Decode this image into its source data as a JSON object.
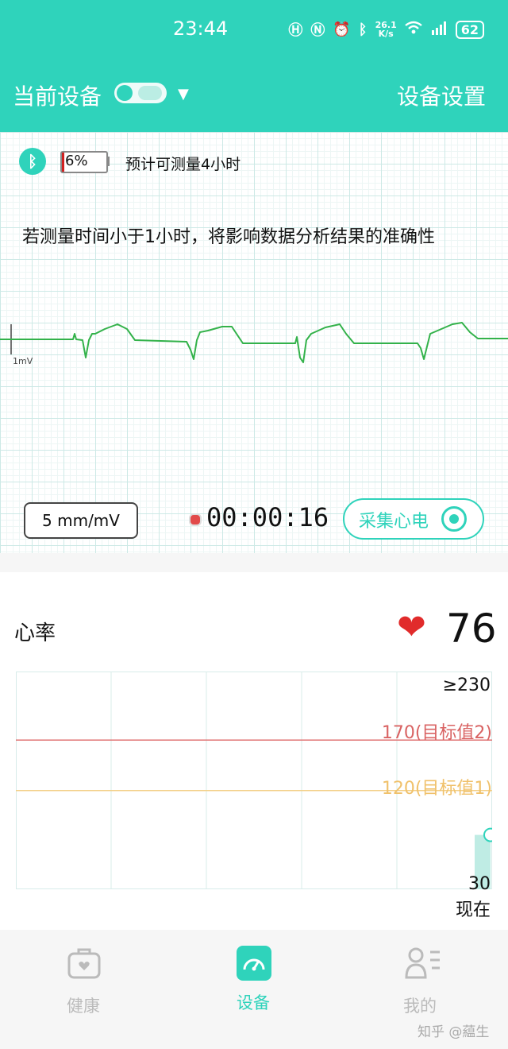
{
  "status_bar": {
    "time": "23:44",
    "net_speed_value": "26.1",
    "net_speed_unit": "K/s",
    "battery_level": "62",
    "icons": [
      "hd-icon",
      "nfc-icon",
      "alarm-icon",
      "bluetooth-icon",
      "wifi-icon",
      "5g-signal-icon"
    ]
  },
  "header": {
    "device_label": "当前设备",
    "settings_label": "设备设置"
  },
  "ecg": {
    "battery_percent": "6%",
    "battery_level": 0.06,
    "estimate_text": "预计可测量4小时",
    "warning_text": "若测量时间小于1小时，将影响数据分析结果的准确性",
    "calibration_label": "1mV",
    "scale_button": "5 mm/mV",
    "timer": "00:00:16",
    "collect_button": "采集心电"
  },
  "heart_rate": {
    "title": "心率",
    "value": "76",
    "chart": {
      "ymax_label": "≥230",
      "target2_label": "170(目标值2)",
      "target1_label": "120(目标值1)",
      "ymin_label": "30",
      "now_label": "现在",
      "ymin": 30,
      "ymax": 230,
      "target2": 170,
      "target1": 120,
      "current": 76
    }
  },
  "bottom_nav": {
    "items": [
      {
        "label": "健康",
        "active": false
      },
      {
        "label": "设备",
        "active": true
      },
      {
        "label": "我的",
        "active": false
      }
    ]
  },
  "watermark": "知乎 @藴生",
  "colors": {
    "accent": "#2fd3bb",
    "ecg_trace": "#33b24a",
    "target2": "#e07070",
    "target1": "#f3cf86",
    "heart": "#e12b2b"
  }
}
